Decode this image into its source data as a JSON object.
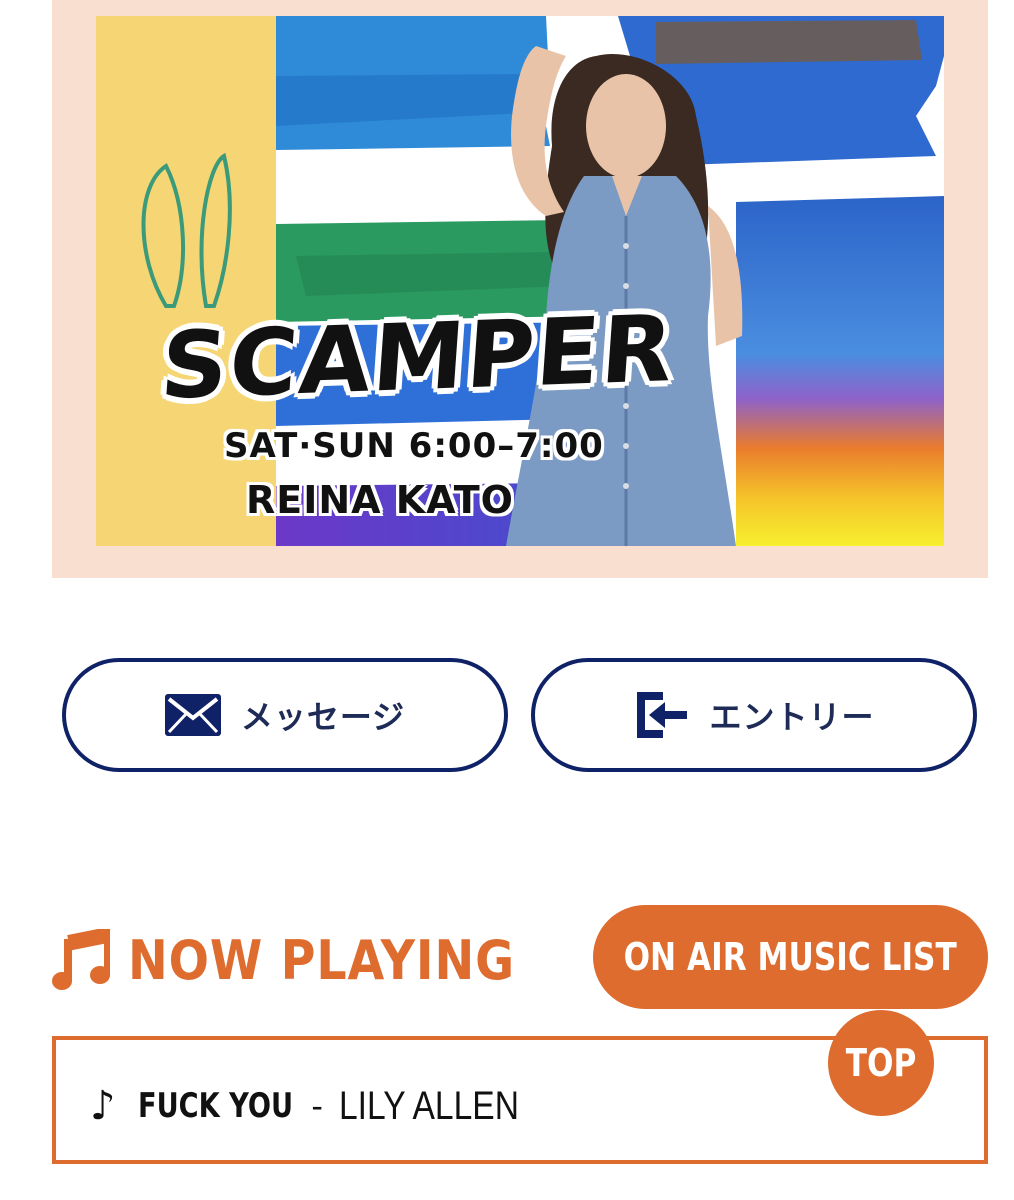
{
  "banner": {
    "program_title": "SCAMPER",
    "schedule": "SAT·SUN  6:00–7:00",
    "host": "REINA KATO"
  },
  "buttons": {
    "message_label": "メッセージ",
    "message_icon": "envelope-icon",
    "entry_label": "エントリー",
    "entry_icon": "entry-arrow-icon"
  },
  "now_playing": {
    "heading": "NOW PLAYING",
    "heading_icon": "music-note-icon",
    "list_button_label": "ON AIR MUSIC LIST",
    "track_note": "♪",
    "track_title": "FUCK YOU",
    "separator": "-",
    "track_artist": "LILY ALLEN"
  },
  "top_button_label": "TOP",
  "colors": {
    "accent_orange": "#dd6c2e",
    "navy": "#0f2267",
    "banner_frame": "#f8dfd0"
  }
}
